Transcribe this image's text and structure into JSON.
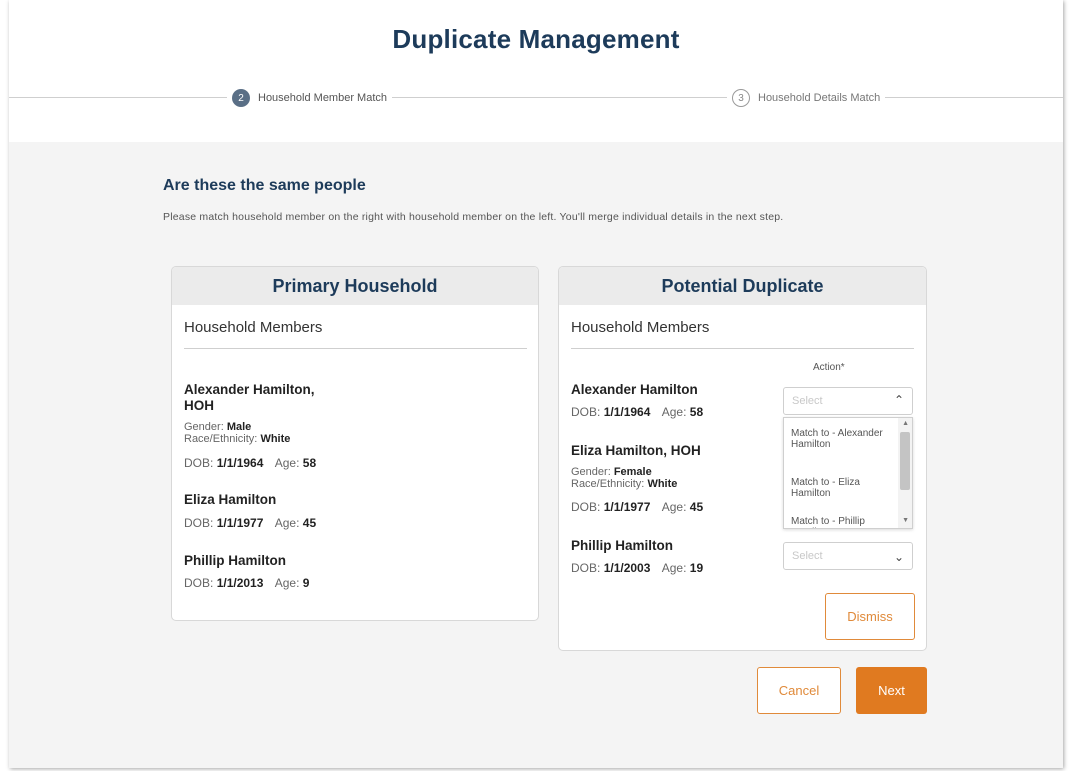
{
  "header": {
    "title": "Duplicate Management",
    "steps": [
      {
        "number": "2",
        "label": "Household Member Match",
        "state": "active"
      },
      {
        "number": "3",
        "label": "Household Details Match",
        "state": "upcoming"
      }
    ]
  },
  "main": {
    "heading": "Are these the same people",
    "instructions": "Please match household member on the right with household member on the left. You'll merge individual details in the next step."
  },
  "primary": {
    "title": "Primary Household",
    "members_title": "Household Members",
    "members": [
      {
        "name_line1": "Alexander Hamilton,",
        "name_line2": "HOH",
        "gender_label": "Gender:",
        "gender": "Male",
        "race_label": "Race/Ethnicity:",
        "race": "White",
        "dob_label": "DOB:",
        "dob": "1/1/1964",
        "age_label": "Age:",
        "age": "58"
      },
      {
        "name": "Eliza Hamilton",
        "dob_label": "DOB:",
        "dob": "1/1/1977",
        "age_label": "Age:",
        "age": "45"
      },
      {
        "name": "Phillip Hamilton",
        "dob_label": "DOB:",
        "dob": "1/1/2013",
        "age_label": "Age:",
        "age": "9"
      }
    ]
  },
  "duplicate": {
    "title": "Potential Duplicate",
    "members_title": "Household Members",
    "action_label": "Action*",
    "members": [
      {
        "name": "Alexander Hamilton",
        "dob_label": "DOB:",
        "dob": "1/1/1964",
        "age_label": "Age:",
        "age": "58"
      },
      {
        "name": "Eliza Hamilton, HOH",
        "gender_label": "Gender:",
        "gender": "Female",
        "race_label": "Race/Ethnicity:",
        "race": "White",
        "dob_label": "DOB:",
        "dob": "1/1/1977",
        "age_label": "Age:",
        "age": "45"
      },
      {
        "name": "Phillip Hamilton",
        "dob_label": "DOB:",
        "dob": "1/1/2003",
        "age_label": "Age:",
        "age": "19"
      }
    ],
    "select_placeholder": "Select",
    "dropdown_options": [
      "Match to - Alexander Hamilton",
      "Match to - Eliza Hamilton",
      "Match to - Phillip Hamilton"
    ],
    "dismiss_label": "Dismiss"
  },
  "footer": {
    "cancel_label": "Cancel",
    "next_label": "Next"
  },
  "colors": {
    "accent": "#e07a20",
    "heading": "#1d3b5a",
    "background": "#f4f4f4"
  }
}
